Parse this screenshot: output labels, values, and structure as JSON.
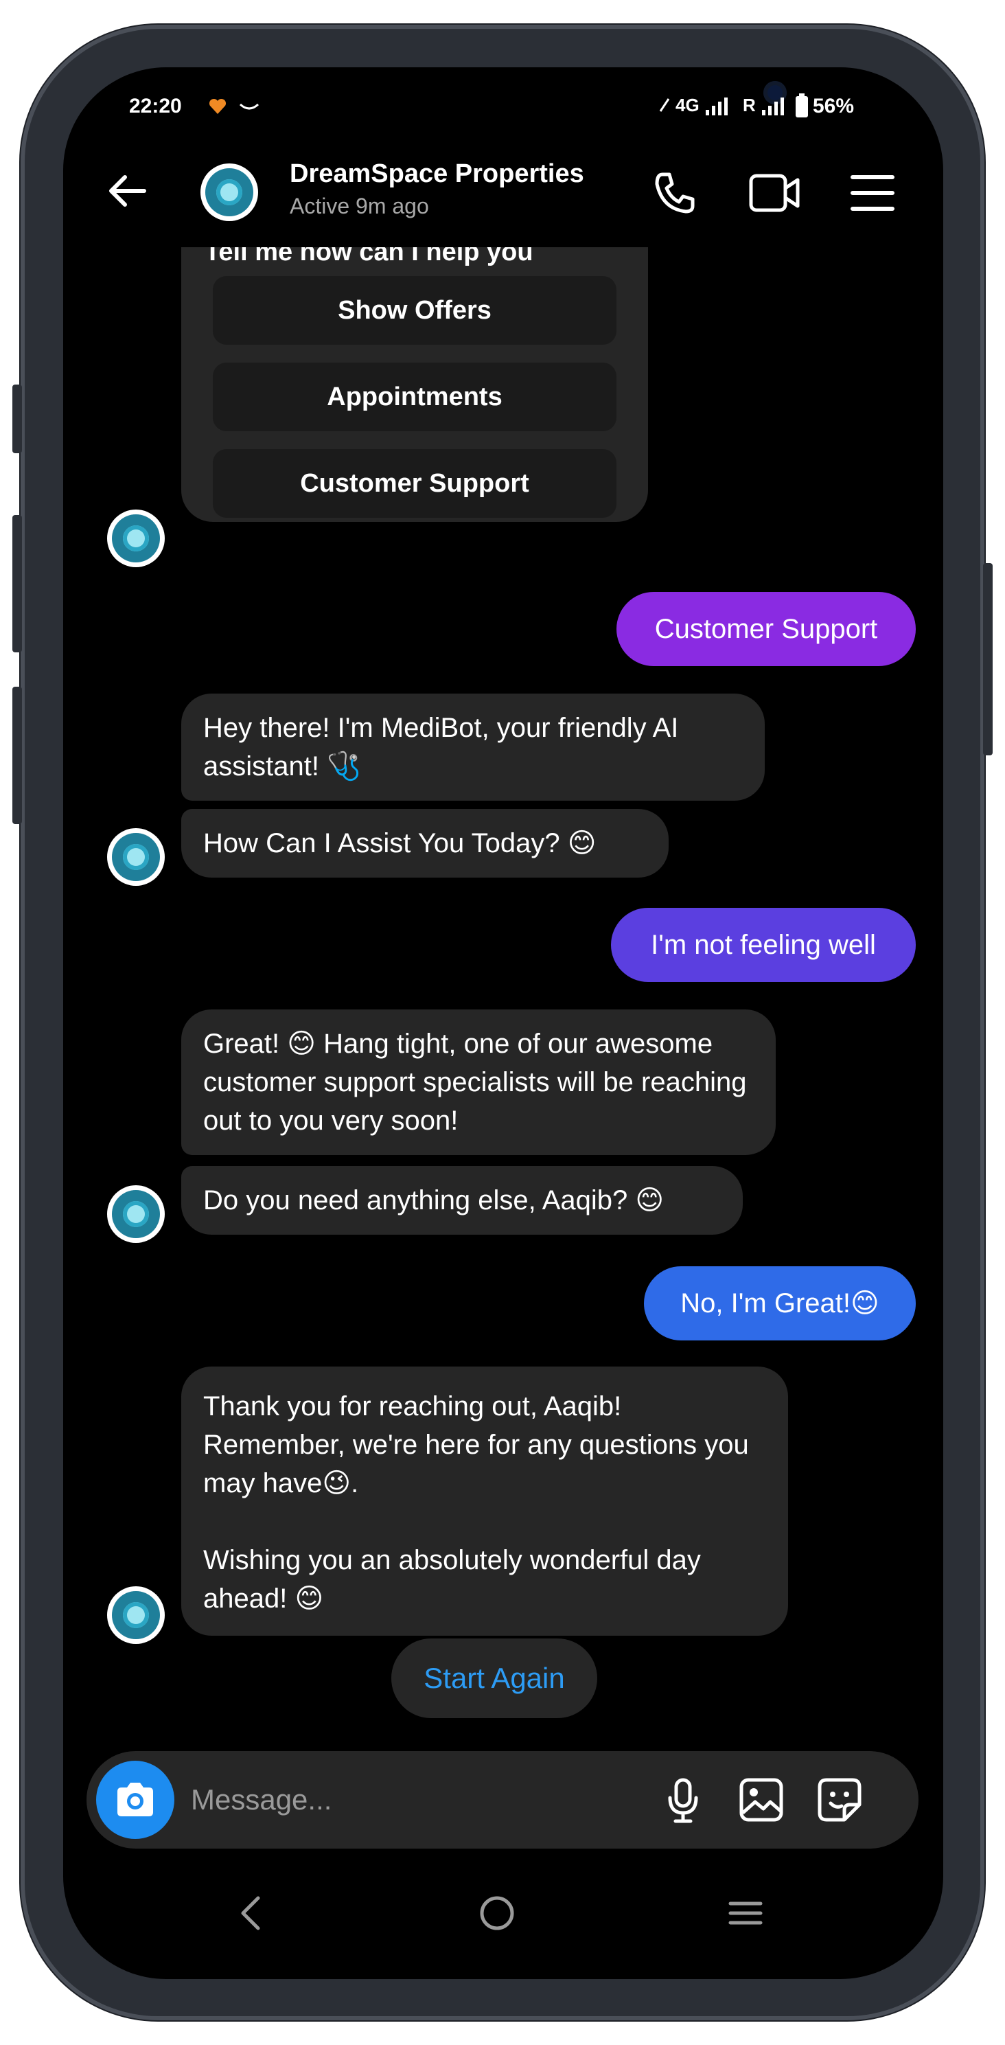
{
  "status_bar": {
    "time": "22:20",
    "network_1": "4G",
    "network_2": "R",
    "battery": "56%"
  },
  "header": {
    "contact_name": "DreamSpace Properties",
    "activity": "Active 9m ago",
    "icons": [
      "back-arrow-icon",
      "phone-icon",
      "video-icon",
      "menu-icon"
    ]
  },
  "quick_reply_card": {
    "heading": "Tell me how can I help you",
    "options": [
      "Show Offers",
      "Appointments",
      "Customer Support"
    ]
  },
  "messages": [
    {
      "from": "user",
      "text": "Customer Support",
      "color": "#8a2be2"
    },
    {
      "from": "bot",
      "text": "Hey there! I'm MediBot, your friendly AI assistant! 🩺"
    },
    {
      "from": "bot",
      "text": "How Can I Assist You Today? 😊"
    },
    {
      "from": "user",
      "text": "I'm not feeling well",
      "color": "#5b3fe0"
    },
    {
      "from": "bot",
      "text": "Great! 😊 Hang tight, one of our awesome customer support specialists will be reaching out to you very soon!"
    },
    {
      "from": "bot",
      "text": "Do you need anything else, Aaqib? 😊"
    },
    {
      "from": "user",
      "text": "No, I'm Great!😊",
      "color": "#2f6be8"
    },
    {
      "from": "bot",
      "text": "Thank you for reaching out, Aaqib! Remember, we're here for any questions you may have😉.",
      "text_2": "Wishing you an absolutely wonderful day ahead! 😊"
    }
  ],
  "start_again": "Start Again",
  "composer": {
    "placeholder": "Message...",
    "icons": [
      "camera-icon",
      "microphone-icon",
      "gallery-icon",
      "sticker-icon"
    ]
  },
  "colors": {
    "background": "#000000",
    "bot_bubble": "#262626",
    "accent_link": "#2d9cf5",
    "camera_button": "#1d8cf0"
  }
}
